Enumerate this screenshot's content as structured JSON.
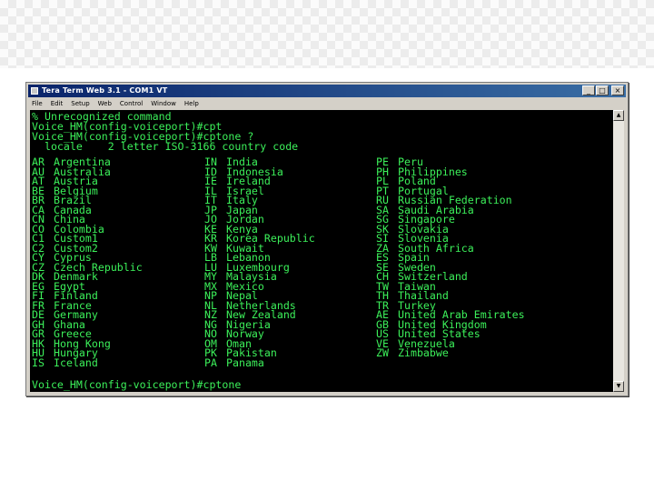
{
  "window": {
    "title": "Tera Term Web 3.1 - COM1 VT",
    "controls": {
      "minimize": "_",
      "maximize": "□",
      "close": "×"
    }
  },
  "menu": [
    "File",
    "Edit",
    "Setup",
    "Web",
    "Control",
    "Window",
    "Help"
  ],
  "terminal": {
    "lines": [
      "% Unrecognized command",
      "Voice_HM(config-voiceport)#cpt",
      "Voice_HM(config-voiceport)#cptone ?",
      "  locale    2 letter ISO-3166 country code"
    ],
    "columns": [
      [
        {
          "code": "AR",
          "name": "Argentina"
        },
        {
          "code": "AU",
          "name": "Australia"
        },
        {
          "code": "AT",
          "name": "Austria"
        },
        {
          "code": "BE",
          "name": "Belgium"
        },
        {
          "code": "BR",
          "name": "Brazil"
        },
        {
          "code": "CA",
          "name": "Canada"
        },
        {
          "code": "CN",
          "name": "China"
        },
        {
          "code": "CO",
          "name": "Colombia"
        },
        {
          "code": "C1",
          "name": "Custom1"
        },
        {
          "code": "C2",
          "name": "Custom2"
        },
        {
          "code": "CY",
          "name": "Cyprus"
        },
        {
          "code": "CZ",
          "name": "Czech Republic"
        },
        {
          "code": "DK",
          "name": "Denmark"
        },
        {
          "code": "EG",
          "name": "Egypt"
        },
        {
          "code": "FI",
          "name": "Finland"
        },
        {
          "code": "FR",
          "name": "France"
        },
        {
          "code": "DE",
          "name": "Germany"
        },
        {
          "code": "GH",
          "name": "Ghana"
        },
        {
          "code": "GR",
          "name": "Greece"
        },
        {
          "code": "HK",
          "name": "Hong Kong"
        },
        {
          "code": "HU",
          "name": "Hungary"
        },
        {
          "code": "IS",
          "name": "Iceland"
        }
      ],
      [
        {
          "code": "IN",
          "name": "India"
        },
        {
          "code": "ID",
          "name": "Indonesia"
        },
        {
          "code": "IE",
          "name": "Ireland"
        },
        {
          "code": "IL",
          "name": "Israel"
        },
        {
          "code": "IT",
          "name": "Italy"
        },
        {
          "code": "JP",
          "name": "Japan"
        },
        {
          "code": "JO",
          "name": "Jordan"
        },
        {
          "code": "KE",
          "name": "Kenya"
        },
        {
          "code": "KR",
          "name": "Korea Republic"
        },
        {
          "code": "KW",
          "name": "Kuwait"
        },
        {
          "code": "LB",
          "name": "Lebanon"
        },
        {
          "code": "LU",
          "name": "Luxembourg"
        },
        {
          "code": "MY",
          "name": "Malaysia"
        },
        {
          "code": "MX",
          "name": "Mexico"
        },
        {
          "code": "NP",
          "name": "Nepal"
        },
        {
          "code": "NL",
          "name": "Netherlands"
        },
        {
          "code": "NZ",
          "name": "New Zealand"
        },
        {
          "code": "NG",
          "name": "Nigeria"
        },
        {
          "code": "NO",
          "name": "Norway"
        },
        {
          "code": "OM",
          "name": "Oman"
        },
        {
          "code": "PK",
          "name": "Pakistan"
        },
        {
          "code": "PA",
          "name": "Panama"
        }
      ],
      [
        {
          "code": "PE",
          "name": "Peru"
        },
        {
          "code": "PH",
          "name": "Philippines"
        },
        {
          "code": "PL",
          "name": "Poland"
        },
        {
          "code": "PT",
          "name": "Portugal"
        },
        {
          "code": "RU",
          "name": "Russian Federation"
        },
        {
          "code": "SA",
          "name": "Saudi Arabia"
        },
        {
          "code": "SG",
          "name": "Singapore"
        },
        {
          "code": "SK",
          "name": "Slovakia"
        },
        {
          "code": "SI",
          "name": "Slovenia"
        },
        {
          "code": "ZA",
          "name": "South Africa"
        },
        {
          "code": "ES",
          "name": "Spain"
        },
        {
          "code": "SE",
          "name": "Sweden"
        },
        {
          "code": "CH",
          "name": "Switzerland"
        },
        {
          "code": "TW",
          "name": "Taiwan"
        },
        {
          "code": "TH",
          "name": "Thailand"
        },
        {
          "code": "TR",
          "name": "Turkey"
        },
        {
          "code": "AE",
          "name": "United Arab Emirates"
        },
        {
          "code": "GB",
          "name": "United Kingdom"
        },
        {
          "code": "US",
          "name": "United States"
        },
        {
          "code": "VE",
          "name": "Venezuela"
        },
        {
          "code": "ZW",
          "name": "Zimbabwe"
        }
      ]
    ],
    "prompt": "Voice_HM(config-voiceport)#cptone"
  },
  "colors": {
    "terminal_background": "#000000",
    "terminal_text": "#3cf05a",
    "titlebar_start": "#0a246a",
    "titlebar_end": "#3a6ea5",
    "window_chrome": "#d4d0c8"
  }
}
